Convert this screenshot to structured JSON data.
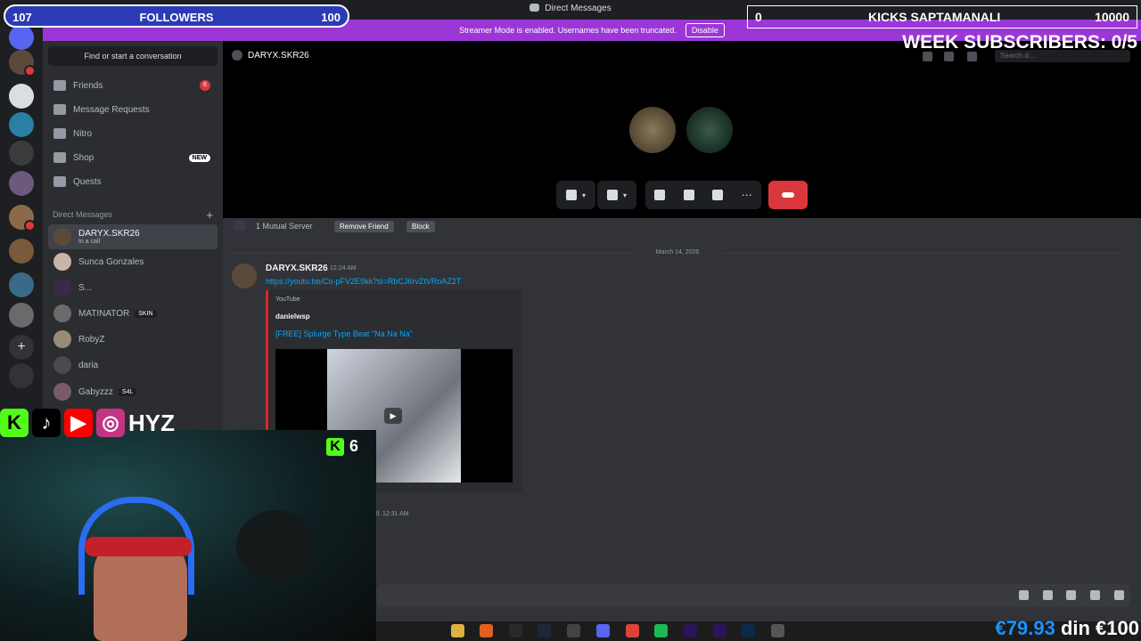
{
  "window": {
    "title": "Direct Messages"
  },
  "banner": {
    "text": "Streamer Mode is enabled. Usernames have been truncated.",
    "button": "Disable"
  },
  "sidebar": {
    "find_placeholder": "Find or start a conversation",
    "nav": [
      {
        "label": "Friends",
        "icon": "friends-icon",
        "count": "6"
      },
      {
        "label": "Message Requests",
        "icon": "envelope-icon"
      },
      {
        "label": "Nitro",
        "icon": "nitro-icon"
      },
      {
        "label": "Shop",
        "icon": "shop-icon",
        "badge": "NEW"
      },
      {
        "label": "Quests",
        "icon": "quests-icon"
      }
    ],
    "dm_header": "Direct Messages",
    "dms": [
      {
        "name": "DARYX.SKR26",
        "status": "In a call"
      },
      {
        "name": "Sunca Gonzales"
      },
      {
        "name": "S..."
      },
      {
        "name": "MATINATOR",
        "tag": "SKIN"
      },
      {
        "name": "RobyZ"
      },
      {
        "name": "daria"
      },
      {
        "name": "Gabyzzz",
        "tag": "S4L"
      }
    ]
  },
  "call": {
    "name": "DARYX.SKR26",
    "search_placeholder": "Search d..."
  },
  "chat": {
    "mutual": "1 Mutual Server",
    "remove_friend": "Remove Friend",
    "block": "Block",
    "date": "March 14, 2026",
    "message": {
      "author": "DARYX.SKR26",
      "time": "12:24 AM",
      "link": "https://youtu.be/Co-pFV2E9kk?si=RbCJ6rvZtVRoAZ2T",
      "embed": {
        "provider": "YouTube",
        "author": "danielwsp",
        "title": "[FREE] Splurge Type Beat \"Na Na Na\""
      }
    },
    "last_time": "ll. 12:31 AM"
  },
  "overlays": {
    "followers": {
      "current": "107",
      "label": "FOLLOWERS",
      "goal": "100"
    },
    "kicks": {
      "current": "0",
      "label": "KICKS SAPTAMANALI",
      "goal": "10000"
    },
    "week_subs": "WEEK SUBSCRIBERS: 0/5",
    "social": {
      "handle": "HYZ"
    },
    "kick_count": "6",
    "money": {
      "euro": "€79.93",
      "rest": " din €100"
    }
  },
  "colors": {
    "accent": "#5865f2",
    "banner": "#9b37d6",
    "danger": "#da373c",
    "link": "#00a8fc"
  }
}
